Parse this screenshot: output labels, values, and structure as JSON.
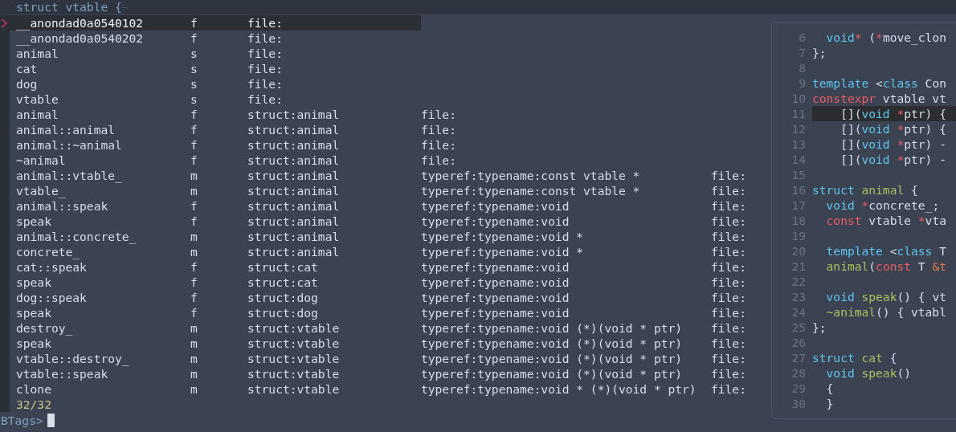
{
  "header": {
    "text": "struct vtable {",
    "eol_mark": "¬"
  },
  "results": [
    {
      "selected": true,
      "fields": [
        "__anondad0a0540102",
        "f",
        "file:"
      ]
    },
    {
      "selected": false,
      "fields": [
        "__anondad0a0540202",
        "f",
        "file:"
      ]
    },
    {
      "selected": false,
      "fields": [
        "animal",
        "s",
        "file:"
      ]
    },
    {
      "selected": false,
      "fields": [
        "cat",
        "s",
        "file:"
      ]
    },
    {
      "selected": false,
      "fields": [
        "dog",
        "s",
        "file:"
      ]
    },
    {
      "selected": false,
      "fields": [
        "vtable",
        "s",
        "file:"
      ]
    },
    {
      "selected": false,
      "fields": [
        "animal",
        "f",
        "struct:animal",
        "file:"
      ]
    },
    {
      "selected": false,
      "fields": [
        "animal::animal",
        "f",
        "struct:animal",
        "file:"
      ]
    },
    {
      "selected": false,
      "fields": [
        "animal::~animal",
        "f",
        "struct:animal",
        "file:"
      ]
    },
    {
      "selected": false,
      "fields": [
        "~animal",
        "f",
        "struct:animal",
        "file:"
      ]
    },
    {
      "selected": false,
      "fields": [
        "animal::vtable_",
        "m",
        "struct:animal",
        "typeref:typename:const vtable *",
        "file:"
      ]
    },
    {
      "selected": false,
      "fields": [
        "vtable_",
        "m",
        "struct:animal",
        "typeref:typename:const vtable *",
        "file:"
      ]
    },
    {
      "selected": false,
      "fields": [
        "animal::speak",
        "f",
        "struct:animal",
        "typeref:typename:void",
        "file:"
      ]
    },
    {
      "selected": false,
      "fields": [
        "speak",
        "f",
        "struct:animal",
        "typeref:typename:void",
        "file:"
      ]
    },
    {
      "selected": false,
      "fields": [
        "animal::concrete_",
        "m",
        "struct:animal",
        "typeref:typename:void *",
        "file:"
      ]
    },
    {
      "selected": false,
      "fields": [
        "concrete_",
        "m",
        "struct:animal",
        "typeref:typename:void *",
        "file:"
      ]
    },
    {
      "selected": false,
      "fields": [
        "cat::speak",
        "f",
        "struct:cat",
        "typeref:typename:void",
        "file:"
      ]
    },
    {
      "selected": false,
      "fields": [
        "speak",
        "f",
        "struct:cat",
        "typeref:typename:void",
        "file:"
      ]
    },
    {
      "selected": false,
      "fields": [
        "dog::speak",
        "f",
        "struct:dog",
        "typeref:typename:void",
        "file:"
      ]
    },
    {
      "selected": false,
      "fields": [
        "speak",
        "f",
        "struct:dog",
        "typeref:typename:void",
        "file:"
      ]
    },
    {
      "selected": false,
      "fields": [
        "destroy_",
        "m",
        "struct:vtable",
        "typeref:typename:void (*)(void * ptr)",
        "file:"
      ]
    },
    {
      "selected": false,
      "fields": [
        "speak",
        "m",
        "struct:vtable",
        "typeref:typename:void (*)(void * ptr)",
        "file:"
      ]
    },
    {
      "selected": false,
      "fields": [
        "vtable::destroy_",
        "m",
        "struct:vtable",
        "typeref:typename:void (*)(void * ptr)",
        "file:"
      ]
    },
    {
      "selected": false,
      "fields": [
        "vtable::speak",
        "m",
        "struct:vtable",
        "typeref:typename:void (*)(void * ptr)",
        "file:"
      ]
    },
    {
      "selected": false,
      "fields": [
        "clone",
        "m",
        "struct:vtable",
        "typeref:typename:void * (*)(void * ptr)",
        "file:"
      ]
    }
  ],
  "count": "32/32",
  "prompt": {
    "label": "BTags>"
  },
  "preview": {
    "lines": [
      {
        "number": "6",
        "selected": false,
        "tokens": [
          {
            "kind": "keyword",
            "text": "  void"
          },
          {
            "kind": "operator",
            "text": "*"
          },
          {
            "kind": "plain",
            "text": " ("
          },
          {
            "kind": "operator",
            "text": "*"
          },
          {
            "kind": "plain",
            "text": "move_clon"
          }
        ]
      },
      {
        "number": "7",
        "selected": false,
        "tokens": [
          {
            "kind": "plain",
            "text": "};"
          }
        ]
      },
      {
        "number": "8",
        "selected": false
      },
      {
        "number": "9",
        "selected": false,
        "tokens": [
          {
            "kind": "keyword",
            "text": "template"
          },
          {
            "kind": "plain",
            "text": " <"
          },
          {
            "kind": "keyword",
            "text": "class"
          },
          {
            "kind": "plain",
            "text": " Con"
          }
        ]
      },
      {
        "number": "10",
        "selected": false,
        "tokens": [
          {
            "kind": "operator",
            "text": "constexpr"
          },
          {
            "kind": "plain",
            "text": " vtable vt"
          }
        ]
      },
      {
        "number": "11",
        "selected": true,
        "tokens": [
          {
            "kind": "plain",
            "text": "    []("
          },
          {
            "kind": "keyword",
            "text": "void "
          },
          {
            "kind": "operator",
            "text": "*"
          },
          {
            "kind": "plain",
            "text": "ptr) {"
          }
        ]
      },
      {
        "number": "12",
        "selected": false,
        "tokens": [
          {
            "kind": "plain",
            "text": "    []("
          },
          {
            "kind": "keyword",
            "text": "void "
          },
          {
            "kind": "operator",
            "text": "*"
          },
          {
            "kind": "plain",
            "text": "ptr) {"
          }
        ]
      },
      {
        "number": "13",
        "selected": false,
        "tokens": [
          {
            "kind": "plain",
            "text": "    []("
          },
          {
            "kind": "keyword",
            "text": "void "
          },
          {
            "kind": "operator",
            "text": "*"
          },
          {
            "kind": "plain",
            "text": "ptr) -"
          }
        ]
      },
      {
        "number": "14",
        "selected": false,
        "tokens": [
          {
            "kind": "plain",
            "text": "    []("
          },
          {
            "kind": "keyword",
            "text": "void "
          },
          {
            "kind": "operator",
            "text": "*"
          },
          {
            "kind": "plain",
            "text": "ptr) -"
          }
        ]
      },
      {
        "number": "15",
        "selected": false
      },
      {
        "number": "16",
        "selected": false,
        "tokens": [
          {
            "kind": "keyword",
            "text": "struct "
          },
          {
            "kind": "function",
            "text": "animal"
          },
          {
            "kind": "plain",
            "text": " {"
          }
        ]
      },
      {
        "number": "17",
        "selected": false,
        "tokens": [
          {
            "kind": "keyword",
            "text": "  void "
          },
          {
            "kind": "operator",
            "text": "*"
          },
          {
            "kind": "plain",
            "text": "concrete_;"
          }
        ]
      },
      {
        "number": "18",
        "selected": false,
        "tokens": [
          {
            "kind": "operator",
            "text": "  const"
          },
          {
            "kind": "plain",
            "text": " vtable "
          },
          {
            "kind": "operator",
            "text": "*"
          },
          {
            "kind": "plain",
            "text": "vta"
          }
        ]
      },
      {
        "number": "19",
        "selected": false
      },
      {
        "number": "20",
        "selected": false,
        "tokens": [
          {
            "kind": "keyword",
            "text": "  template"
          },
          {
            "kind": "plain",
            "text": " <"
          },
          {
            "kind": "keyword",
            "text": "class"
          },
          {
            "kind": "plain",
            "text": " T"
          }
        ]
      },
      {
        "number": "21",
        "selected": false,
        "tokens": [
          {
            "kind": "function",
            "text": "  animal"
          },
          {
            "kind": "plain",
            "text": "("
          },
          {
            "kind": "operator",
            "text": "const"
          },
          {
            "kind": "plain",
            "text": " T "
          },
          {
            "kind": "param",
            "text": "&t"
          }
        ]
      },
      {
        "number": "22",
        "selected": false
      },
      {
        "number": "23",
        "selected": false,
        "tokens": [
          {
            "kind": "keyword",
            "text": "  void "
          },
          {
            "kind": "function",
            "text": "speak"
          },
          {
            "kind": "plain",
            "text": "() { vt"
          }
        ]
      },
      {
        "number": "24",
        "selected": false,
        "tokens": [
          {
            "kind": "function",
            "text": "  ~animal"
          },
          {
            "kind": "plain",
            "text": "() { vtabl"
          }
        ]
      },
      {
        "number": "25",
        "selected": false,
        "tokens": [
          {
            "kind": "plain",
            "text": "};"
          }
        ]
      },
      {
        "number": "26",
        "selected": false
      },
      {
        "number": "27",
        "selected": false,
        "tokens": [
          {
            "kind": "keyword",
            "text": "struct "
          },
          {
            "kind": "function",
            "text": "cat"
          },
          {
            "kind": "plain",
            "text": " {"
          }
        ]
      },
      {
        "number": "28",
        "selected": false,
        "tokens": [
          {
            "kind": "keyword",
            "text": "  void "
          },
          {
            "kind": "function",
            "text": "speak"
          },
          {
            "kind": "plain",
            "text": "()"
          }
        ]
      },
      {
        "number": "29",
        "selected": false,
        "tokens": [
          {
            "kind": "plain",
            "text": "  {"
          }
        ]
      },
      {
        "number": "30",
        "selected": false,
        "tokens": [
          {
            "kind": "plain",
            "text": "  }"
          }
        ]
      }
    ]
  }
}
